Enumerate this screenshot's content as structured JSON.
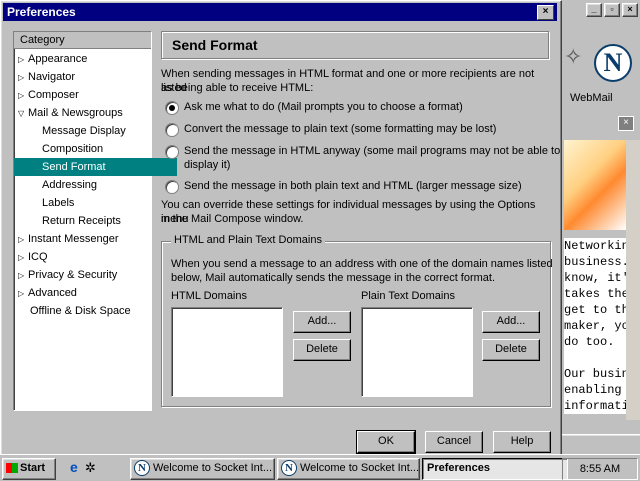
{
  "dialog": {
    "title": "Preferences",
    "close_label": "×"
  },
  "tree": {
    "header": "Category",
    "items": [
      {
        "label": "Appearance",
        "twisty": "▷"
      },
      {
        "label": "Navigator",
        "twisty": "▷"
      },
      {
        "label": "Composer",
        "twisty": "▷"
      },
      {
        "label": "Mail & Newsgroups",
        "twisty": "▽"
      },
      {
        "label": "Message Display"
      },
      {
        "label": "Composition"
      },
      {
        "label": "Send Format"
      },
      {
        "label": "Addressing"
      },
      {
        "label": "Labels"
      },
      {
        "label": "Return Receipts"
      },
      {
        "label": "Instant Messenger",
        "twisty": "▷"
      },
      {
        "label": "ICQ",
        "twisty": "▷"
      },
      {
        "label": "Privacy & Security",
        "twisty": "▷"
      },
      {
        "label": "Advanced",
        "twisty": "▷"
      },
      {
        "label": "Offline & Disk Space"
      }
    ],
    "selected_color": "#008080"
  },
  "panel": {
    "title": "Send Format",
    "intro_1": "When sending messages in HTML format and one or more recipients are not listed",
    "intro_2": "as being able to receive HTML:",
    "options": [
      {
        "line1": "Ask me what to do (Mail prompts you to choose a format)",
        "line2": "",
        "checked": true
      },
      {
        "line1": "Convert the message to plain text (some formatting may be lost)",
        "line2": "",
        "checked": false
      },
      {
        "line1": "Send the message in HTML anyway (some mail programs may not be able to",
        "line2": "display it)",
        "checked": false
      },
      {
        "line1": "Send the message in both plain text and HTML (larger message size)",
        "line2": "",
        "checked": false
      }
    ],
    "override_1": "You can override these settings for individual messages by using the Options menu",
    "override_2": "in the Mail Compose window.",
    "domains": {
      "title": "HTML and Plain Text Domains",
      "desc_1": "When you send a message to an address with one of the domain names listed",
      "desc_2": "below, Mail automatically sends the message in the correct format.",
      "html_label": "HTML Domains",
      "plain_label": "Plain Text Domains",
      "add_label": "Add...",
      "delete_label": "Delete"
    }
  },
  "buttons": {
    "ok": "OK",
    "cancel": "Cancel",
    "help": "Help"
  },
  "background_window": {
    "webmail": "WebMail",
    "text_lines": [
      "Networkin",
      "business.",
      "know, it's",
      "takes the",
      "get to th",
      "maker, yo",
      "do too.",
      "",
      "Our busin",
      "enabling ",
      "informatio"
    ]
  },
  "taskbar": {
    "start": "Start",
    "tasks": [
      {
        "label": "Welcome to Socket Int...",
        "active": false
      },
      {
        "label": "Welcome to Socket Int...",
        "active": false
      },
      {
        "label": "Preferences",
        "active": true
      }
    ],
    "clock": "8:55 AM"
  }
}
